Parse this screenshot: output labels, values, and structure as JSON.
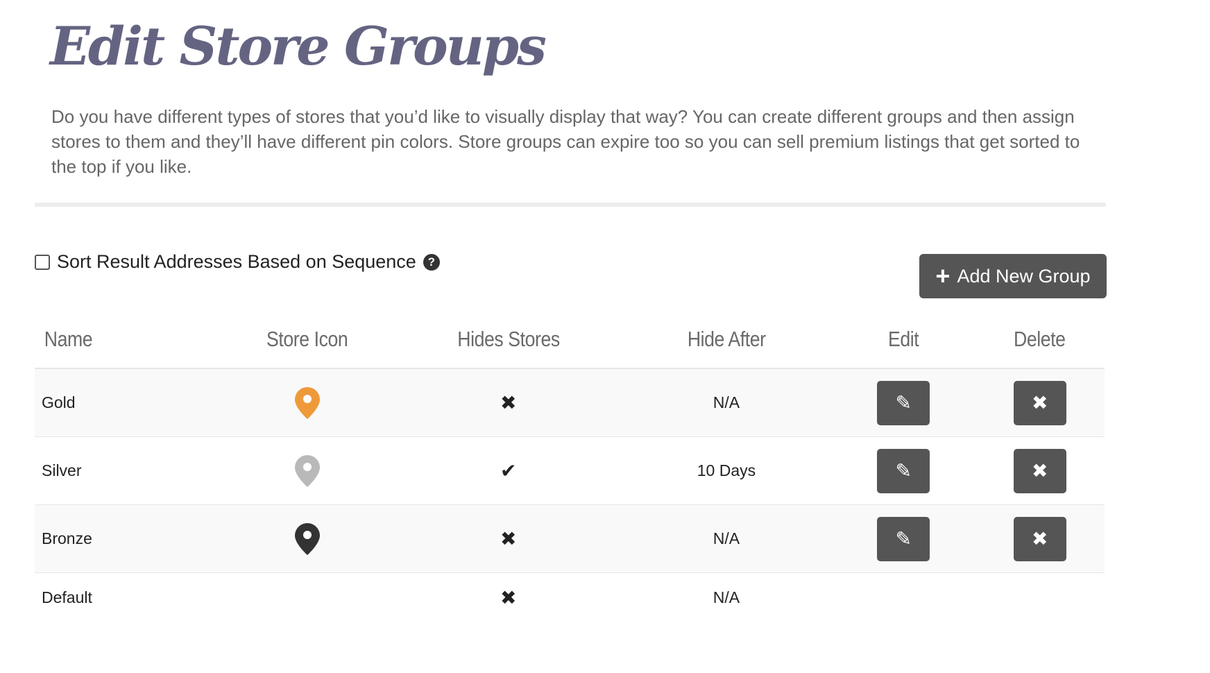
{
  "page": {
    "title": "Edit Store Groups",
    "intro": "Do you have different types of stores that you’d like to visually display that way? You can create different groups and then assign stores to them and they’ll have different pin colors. Store groups can expire too so you can sell premium listings that get sorted to the top if you like."
  },
  "sort_option": {
    "label": "Sort Result Addresses Based on Sequence",
    "checked": false,
    "help_icon": "question-circle-icon",
    "help_glyph": "?"
  },
  "add_button": {
    "label": "Add New Group",
    "icon": "plus-icon",
    "icon_glyph": "+"
  },
  "table": {
    "headers": [
      "Name",
      "Store Icon",
      "Hides Stores",
      "Hide After",
      "Edit",
      "Delete"
    ],
    "rows": [
      {
        "name": "Gold",
        "pin_color": "#ee9a3a",
        "hides_stores": false,
        "hides_glyph": "✖",
        "hide_after": "N/A",
        "edit_glyph": "✎",
        "delete_glyph": "✖"
      },
      {
        "name": "Silver",
        "pin_color": "#b9b9b9",
        "hides_stores": true,
        "hides_glyph": "✔",
        "hide_after": "10 Days",
        "edit_glyph": "✎",
        "delete_glyph": "✖"
      },
      {
        "name": "Bronze",
        "pin_color": "#333333",
        "hides_stores": false,
        "hides_glyph": "✖",
        "hide_after": "N/A",
        "edit_glyph": "✎",
        "delete_glyph": "✖"
      },
      {
        "name": "Default",
        "hides_stores": false,
        "hides_glyph": "✖",
        "hide_after": "N/A"
      }
    ]
  },
  "colors": {
    "title": "#646482",
    "button": "#555555",
    "divider": "#ededed"
  }
}
